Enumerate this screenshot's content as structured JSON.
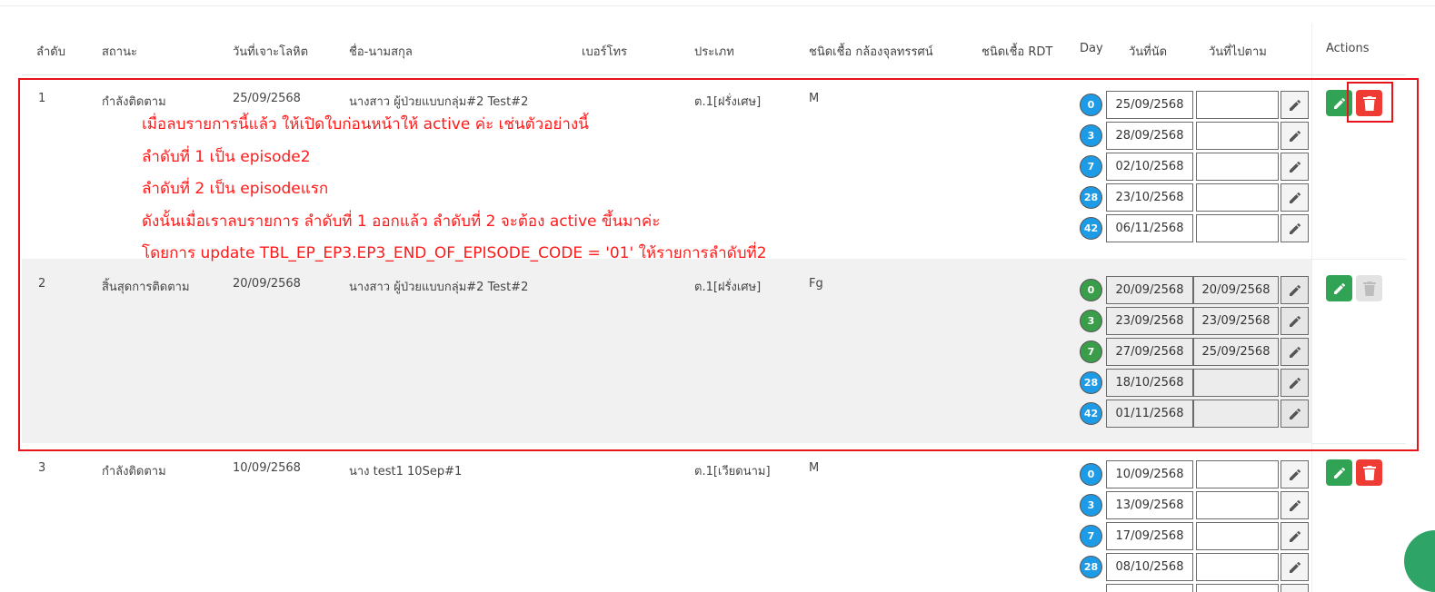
{
  "headers": {
    "order": "ลำดับ",
    "status": "สถานะ",
    "blood_date": "วันที่เจาะโลหิต",
    "name": "ชื่อ-นามสกุล",
    "phone": "เบอร์โทร",
    "type": "ประเภท",
    "microscope": "ชนิดเชื้อ กล้องจุลทรรศน์",
    "rdt": "ชนิดเชื้อ RDT",
    "day": "Day",
    "appointment": "วันที่นัด",
    "followed": "วันที่ไปตาม",
    "actions": "Actions"
  },
  "rows": [
    {
      "order": "1",
      "status": "กำลังติดตาม",
      "blood_date": "25/09/2568",
      "name": "นางสาว ผู้ป่วยแบบกลุ่ม#2 Test#2",
      "phone": "",
      "type": "ต.1[ฝรั่งเศษ]",
      "microscope": "M",
      "rdt": "",
      "appointments": [
        {
          "day": "0",
          "date": "25/09/2568",
          "followed": ""
        },
        {
          "day": "3",
          "date": "28/09/2568",
          "followed": ""
        },
        {
          "day": "7",
          "date": "02/10/2568",
          "followed": ""
        },
        {
          "day": "28",
          "date": "23/10/2568",
          "followed": ""
        },
        {
          "day": "42",
          "date": "06/11/2568",
          "followed": ""
        }
      ]
    },
    {
      "order": "2",
      "status": "สิ้นสุดการติดตาม",
      "blood_date": "20/09/2568",
      "name": "นางสาว ผู้ป่วยแบบกลุ่ม#2 Test#2",
      "phone": "",
      "type": "ต.1[ฝรั่งเศษ]",
      "microscope": "Fg",
      "rdt": "",
      "appointments": [
        {
          "day": "0",
          "date": "20/09/2568",
          "followed": "20/09/2568"
        },
        {
          "day": "3",
          "date": "23/09/2568",
          "followed": "23/09/2568"
        },
        {
          "day": "7",
          "date": "27/09/2568",
          "followed": "25/09/2568"
        },
        {
          "day": "28",
          "date": "18/10/2568",
          "followed": ""
        },
        {
          "day": "42",
          "date": "01/11/2568",
          "followed": ""
        }
      ]
    },
    {
      "order": "3",
      "status": "กำลังติดตาม",
      "blood_date": "10/09/2568",
      "name": "นาง test1 10Sep#1",
      "phone": "",
      "type": "ต.1[เวียดนาม]",
      "microscope": "M",
      "rdt": "",
      "appointments": [
        {
          "day": "0",
          "date": "10/09/2568",
          "followed": ""
        },
        {
          "day": "3",
          "date": "13/09/2568",
          "followed": ""
        },
        {
          "day": "7",
          "date": "17/09/2568",
          "followed": ""
        },
        {
          "day": "28",
          "date": "08/10/2568",
          "followed": ""
        }
      ]
    }
  ],
  "annotation": [
    "เมื่อลบรายการนี้แล้ว ให้เปิดใบก่อนหน้าให้ active ค่ะ เช่นตัวอย่างนี้",
    "ลำดับที่ 1 เป็น episode2",
    "ลำดับที่ 2 เป็น episodeแรก",
    "ดังนั้นเมื่อเราลบรายการ ลำดับที่ 1 ออกแล้ว ลำดับที่ 2 จะต้อง active ขึ้นมาค่ะ",
    "โดยการ update  TBL_EP_EP3.EP3_END_OF_EPISODE_CODE = '01' ให้รายการลำดับที่2"
  ],
  "colors": {
    "badge_pending": "#1e9be6",
    "badge_done": "#3a9d4a",
    "edit_button": "#31a354",
    "delete_button": "#ee3b33",
    "annotation": "#ff1a1a"
  }
}
